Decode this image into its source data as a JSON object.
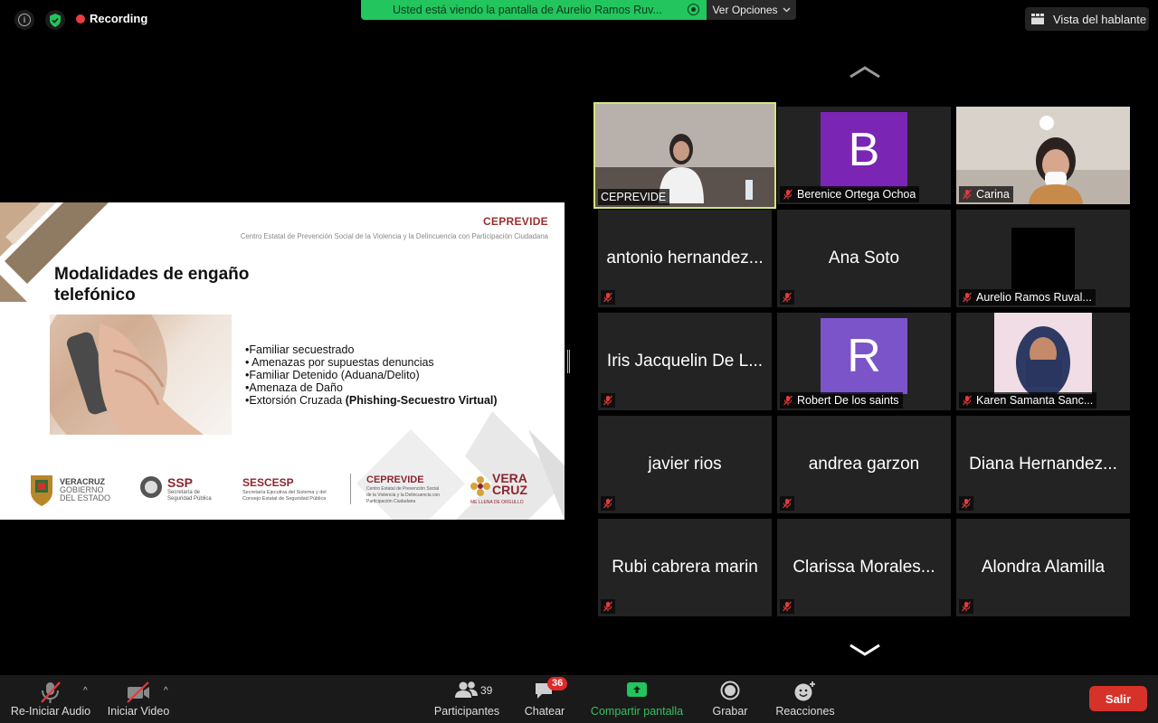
{
  "topbar": {
    "recording_label": "Recording",
    "share_banner": "Usted está viendo la pantalla de Aurelio Ramos Ruv...",
    "view_options": "Ver Opciones",
    "speaker_view": "Vista del hablante"
  },
  "slide": {
    "brand": "CEPREVIDE",
    "subtitle": "Centro Estatal de Prevención Social de la Violencia y la Delincuencia con Participación Ciudadana",
    "title_line1": "Modalidades de engaño",
    "title_line2": "telefónico",
    "bullets": [
      "•Familiar secuestrado",
      "• Amenazas por supuestas denuncias",
      "•Familiar Detenido  (Aduana/Delito)",
      "•Amenaza de Daño",
      "•Extorsión Cruzada "
    ],
    "bullet_bold": "(Phishing-Secuestro Virtual)",
    "logos": {
      "veracruz_1": "VERACRUZ",
      "veracruz_2": "GOBIERNO",
      "veracruz_3": "DEL ESTADO",
      "ssp": "SSP",
      "ssp_sub1": "Secretaría de",
      "ssp_sub2": "Seguridad Pública",
      "sescesp": "SESCESP",
      "sescesp_sub1": "Secretaría Ejecutiva del Sistema y del",
      "sescesp_sub2": "Consejo Estatal de Seguridad Pública",
      "ceprevide": "CEPREVIDE",
      "ceprevide_sub1": "Centro Estatal de Prevención Social",
      "ceprevide_sub2": "de la Violencia y la Delincuencia con",
      "ceprevide_sub3": "Participación Ciudadana",
      "vera": "VERA",
      "cruz": "CRUZ",
      "vera_sub": "ME LLENA DE ORGULLO"
    }
  },
  "gallery": [
    {
      "name": "CEPREVIDE",
      "type": "video",
      "active": true
    },
    {
      "name": "Berenice Ortega Ochoa",
      "type": "avatar",
      "letter": "B",
      "color": "#7b25b5"
    },
    {
      "name": "Carina",
      "type": "video"
    },
    {
      "name": "antonio hernandez...",
      "type": "name"
    },
    {
      "name": "Ana Soto",
      "type": "name"
    },
    {
      "name": "Aurelio Ramos Ruval...",
      "type": "black"
    },
    {
      "name": "Iris Jacquelin De L...",
      "type": "name"
    },
    {
      "name": "Robert De los saints",
      "type": "avatar",
      "letter": "R",
      "color": "#7b54c9"
    },
    {
      "name": "Karen Samanta Sanc...",
      "type": "photo"
    },
    {
      "name": "javier rios",
      "type": "name"
    },
    {
      "name": "andrea  garzon",
      "type": "name"
    },
    {
      "name": "Diana Hernandez...",
      "type": "name"
    },
    {
      "name": "Rubi cabrera marin",
      "type": "name"
    },
    {
      "name": "Clarissa Morales...",
      "type": "name"
    },
    {
      "name": "Alondra Alamilla",
      "type": "name"
    }
  ],
  "toolbar": {
    "audio": "Re-Iniciar Audio",
    "video": "Iniciar Video",
    "participants": "Participantes",
    "participants_count": "39",
    "chat": "Chatear",
    "chat_badge": "36",
    "share": "Compartir pantalla",
    "record": "Grabar",
    "reactions": "Reacciones",
    "leave": "Salir"
  }
}
